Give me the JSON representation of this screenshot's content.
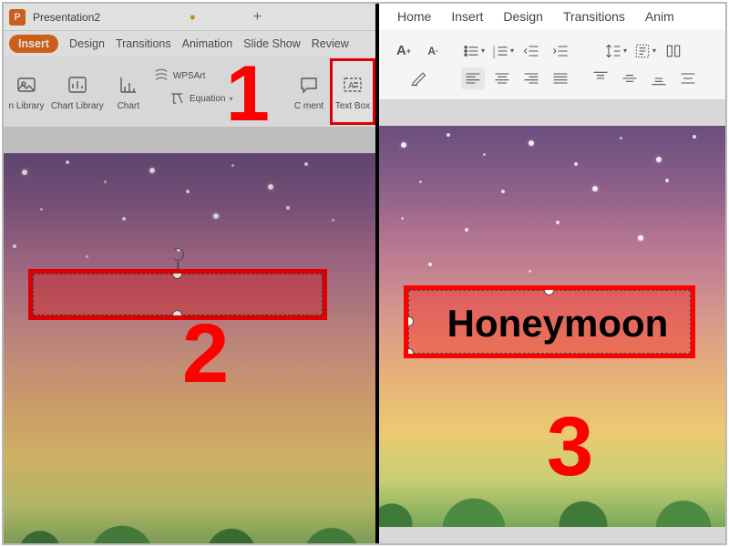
{
  "app": {
    "icon_letter": "P",
    "document_name": "Presentation2",
    "new_tab_glyph": "+"
  },
  "left_tabs": {
    "insert": "Insert",
    "design": "Design",
    "transitions": "Transitions",
    "animation": "Animation",
    "slideshow": "Slide Show",
    "review": "Review"
  },
  "right_tabs": {
    "home": "Home",
    "insert": "Insert",
    "design": "Design",
    "transitions": "Transitions",
    "anim": "Anim"
  },
  "ribbon": {
    "icon_library": "n Library",
    "chart_library": "Chart Library",
    "chart": "Chart",
    "wpsart": "WPSArt",
    "equation": "Equation",
    "comment": "C    ment",
    "text_box": "Text Box"
  },
  "right_ribbon": {
    "grow_font": "A",
    "shrink_font": "A"
  },
  "textbox": {
    "typed_text": "Honeymoon"
  },
  "steps": {
    "one": "1",
    "two": "2",
    "three": "3"
  }
}
